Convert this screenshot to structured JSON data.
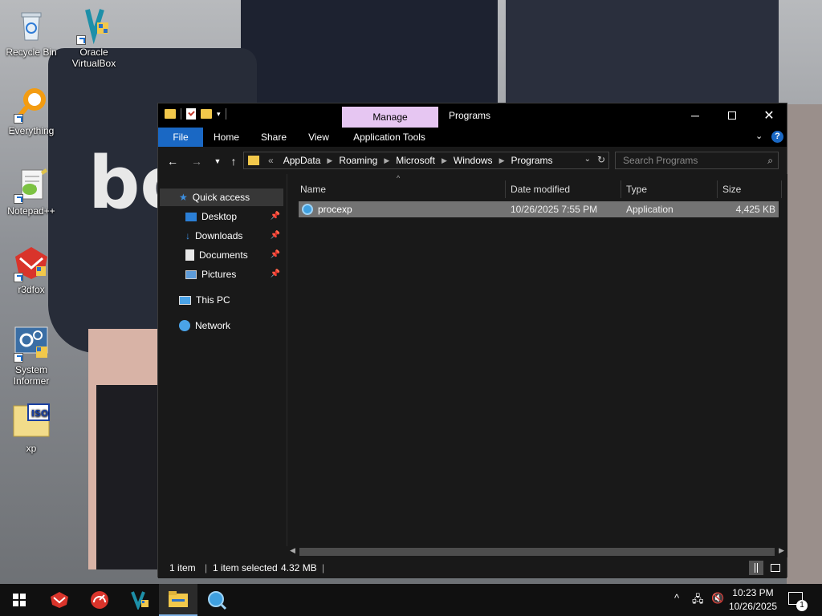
{
  "desktop": {
    "wallpaper_text": "bo",
    "icons": [
      {
        "label": "Recycle Bin"
      },
      {
        "label": "Oracle VirtualBox"
      },
      {
        "label": "Everything"
      },
      {
        "label": "Notepad++"
      },
      {
        "label": "r3dfox"
      },
      {
        "label": "System Informer"
      },
      {
        "label": "xp"
      }
    ]
  },
  "window": {
    "title": "Programs",
    "manage_tab": "Manage",
    "ribbon_tabs": [
      "File",
      "Home",
      "Share",
      "View",
      "Application Tools"
    ],
    "address": {
      "crumbs": [
        "AppData",
        "Roaming",
        "Microsoft",
        "Windows",
        "Programs"
      ],
      "overflow": "«"
    },
    "search_placeholder": "Search Programs",
    "nav": {
      "quick_access": "Quick access",
      "desktop": "Desktop",
      "downloads": "Downloads",
      "documents": "Documents",
      "pictures": "Pictures",
      "this_pc": "This PC",
      "network": "Network"
    },
    "columns": [
      "Name",
      "Date modified",
      "Type",
      "Size"
    ],
    "files": [
      {
        "name": "procexp",
        "date": "10/26/2025 7:55 PM",
        "type": "Application",
        "size": "4,425 KB"
      }
    ],
    "status": {
      "items": "1 item",
      "selected": "1 item selected",
      "selected_size": "4.32 MB"
    }
  },
  "taskbar": {
    "time": "10:23 PM",
    "date": "10/26/2025",
    "notification_count": "1"
  },
  "colors": {
    "accent": "#1a68c4",
    "manage_tab": "#e6c6f2",
    "folder": "#f2c84b",
    "selection": "#737373"
  }
}
